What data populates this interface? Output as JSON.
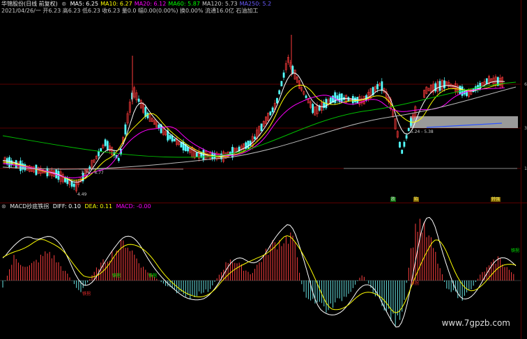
{
  "header": {
    "title": "华锦股份(日线 前复权)",
    "ma": [
      {
        "label": "MA5: 6.25",
        "color": "#ffffff"
      },
      {
        "label": "MA10: 6.27",
        "color": "#ffff00"
      },
      {
        "label": "MA20: 6.12",
        "color": "#ff00ff"
      },
      {
        "label": "MA60: 5.87",
        "color": "#00ff00"
      },
      {
        "label": "MA120: 5.73",
        "color": "#cccccc"
      },
      {
        "label": "MA250: 5.2",
        "color": "#6a5cff"
      }
    ],
    "info_line": "2021/04/26/一 开6.23 高6.23 低6.23 收6.23 量0.0 幅0.00(0.00%) 换0.00% 流通16.0亿 石油加工"
  },
  "main_labels": {
    "low_left": "4.49",
    "range_left": "3.76 - 4.77",
    "range_right": "5.24 - 5.38",
    "axis": [
      "6",
      "3",
      "1"
    ]
  },
  "bottom_tags": [
    {
      "text": "跌",
      "color": "#00ff00"
    },
    {
      "text": "陷",
      "color": "#ffff00"
    },
    {
      "text": "转强",
      "color": "#ffff00"
    }
  ],
  "macd_header": {
    "title": "MACD抄底铁拐",
    "diff": "DIFF: 0.10",
    "dea": "DEA: 0.11",
    "macd": "MACD: -0.00"
  },
  "macd_tags": [
    {
      "text": "铁拐",
      "color": "#ff3030"
    },
    {
      "text": "铁拐",
      "color": "#00ff00"
    },
    {
      "text": "铁拐",
      "color": "#00ff00"
    },
    {
      "text": "铁拐",
      "color": "#ff3030"
    },
    {
      "text": "铁拐",
      "color": "#00ff00"
    }
  ],
  "watermark": "www.7gpzb.com"
}
